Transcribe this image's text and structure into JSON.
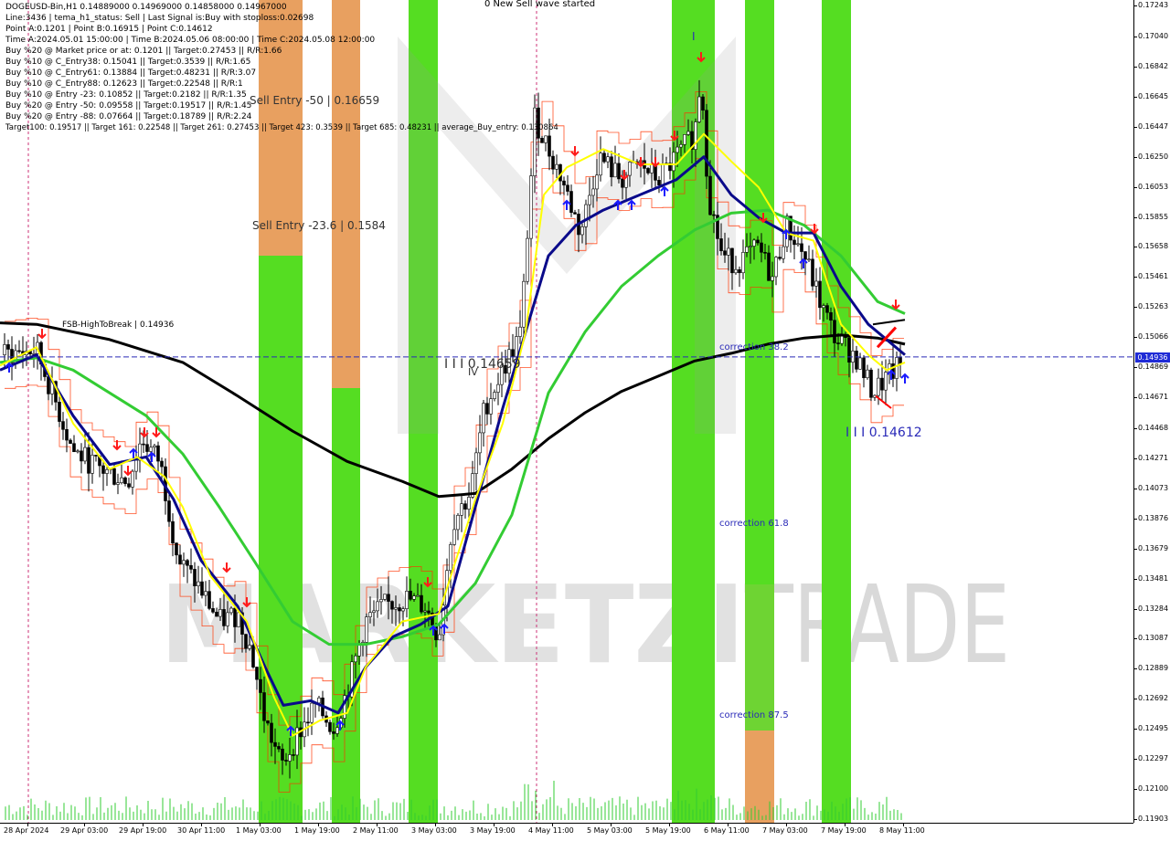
{
  "info": {
    "symbol_line": "DOGEUSD-Bin,H1  0.14889000 0.14969000 0.14858000 0.14967000",
    "status_line": "Line:3436 | tema_h1_status: Sell | Last Signal is:Buy with stoploss:0.02698",
    "points_line": "Point A:0.1201 | Point B:0.16915 | Point C:0.14612",
    "times_line": "Time A:2024.05.01 15:00:00 | Time B:2024.05.06 08:00:00 | Time C:2024.05.08 12:00:00",
    "trade_lines": [
      "Buy %20 @ Market price or at: 0.1201 || Target:0.27453 || R/R:1.66",
      "Buy %10 @ C_Entry38: 0.15041 || Target:0.3539 || R/R:1.65",
      "Buy %10 @ C_Entry61: 0.13884 || Target:0.48231 || R/R:3.07",
      "Buy %10 @ C_Entry88: 0.12623 || Target:0.22548 || R/R:1",
      "Buy %10 @ Entry -23: 0.10852 || Target:0.2182 || R/R:1.35",
      "Buy %20 @ Entry -50: 0.09558 || Target:0.19517 || R/R:1.45",
      "Buy %20 @ Entry -88: 0.07664 || Target:0.18789 || R/R:2.24"
    ],
    "targets_line": "Target100: 0.19517 || Target 161: 0.22548 || Target 261: 0.27453 || Target 423: 0.3539 || Target 685: 0.48231 || average_Buy_entry: 0.130864"
  },
  "annotations": {
    "wave_status": "0 New Sell wave started",
    "sell_entry_50": "Sell Entry -50 | 0.16659",
    "sell_entry_23": "Sell Entry -23.6 | 0.1584",
    "fsb_label": "FSB-HighToBreak | 0.14936",
    "wave_iv_label": "I I I 0.14659",
    "wave_iv_sub": "IV",
    "point_c_label": "I I I 0.14612",
    "wave_top_label": "I",
    "correction_38": "correction 38.2",
    "correction_61": "correction 61.8",
    "correction_87": "correction 87.5"
  },
  "watermark": {
    "left": "MARKETZI",
    "right": "TRADE"
  },
  "price_axis": {
    "labels": [
      "0.17243",
      "0.17040",
      "0.16842",
      "0.16645",
      "0.16447",
      "0.16250",
      "0.16053",
      "0.15855",
      "0.15658",
      "0.15461",
      "0.15263",
      "0.15066",
      "0.14869",
      "0.14671",
      "0.14468",
      "0.14271",
      "0.14073",
      "0.13876",
      "0.13679",
      "0.13481",
      "0.13284",
      "0.13087",
      "0.12889",
      "0.12692",
      "0.12495",
      "0.12297",
      "0.12100",
      "0.11903"
    ],
    "current_price": "0.14936"
  },
  "time_axis": {
    "labels": [
      "28 Apr 2024",
      "29 Apr 03:00",
      "29 Apr 19:00",
      "30 Apr 11:00",
      "1 May 03:00",
      "1 May 19:00",
      "2 May 11:00",
      "3 May 03:00",
      "3 May 19:00",
      "4 May 11:00",
      "5 May 03:00",
      "5 May 19:00",
      "6 May 11:00",
      "7 May 03:00",
      "7 May 19:00",
      "8 May 11:00"
    ]
  },
  "colors": {
    "green_zone": "#55dd22",
    "orange_zone": "#e8a060",
    "candle": "#000000",
    "ma_black": "#000000",
    "ma_green": "#33cc33",
    "ma_navy": "#0a0a8a",
    "ma_yellow": "#ffff00",
    "envelope": "#ff3300",
    "buy_arrow": "#1a1aff",
    "sell_arrow": "#ff1a1a",
    "fsb_line": "#2a2ab8"
  }
}
